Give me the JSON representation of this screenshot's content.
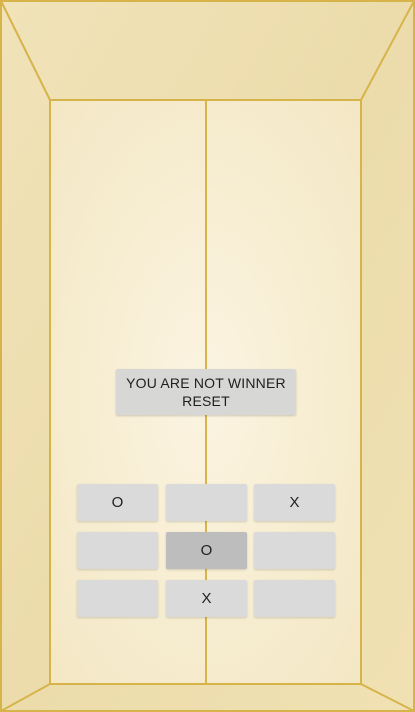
{
  "status": {
    "line1": "YOU ARE NOT WINNER",
    "line2": "RESET"
  },
  "board": {
    "cells": [
      "O",
      "",
      "X",
      "",
      "O",
      "",
      "",
      "X",
      ""
    ],
    "pressed_index": 4
  },
  "colors": {
    "gold_line": "#d6b44a",
    "parchment": "#f7eed6",
    "button": "#dadada",
    "button_pressed": "#bdbdbd"
  }
}
